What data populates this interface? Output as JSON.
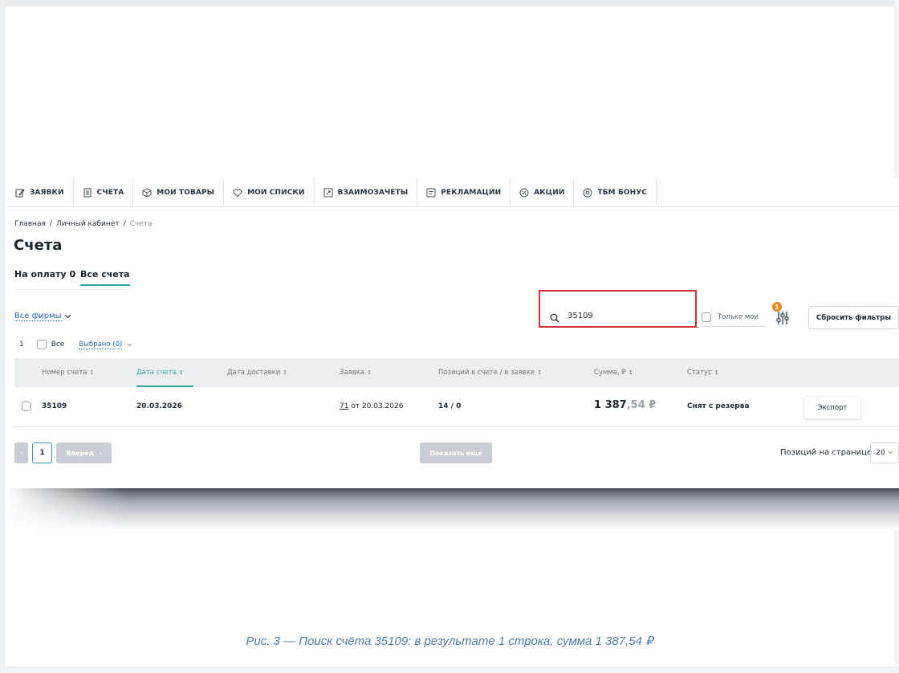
{
  "nav": {
    "items": [
      {
        "label": "ЗАЯВКИ",
        "icon": "edit-icon"
      },
      {
        "label": "СЧЕТА",
        "icon": "document-icon"
      },
      {
        "label": "МОИ ТОВАРЫ",
        "icon": "box-icon"
      },
      {
        "label": "МОИ СПИСКИ",
        "icon": "heart-icon"
      },
      {
        "label": "ВЗАИМОЗАЧЕТЫ",
        "icon": "exchange-icon"
      },
      {
        "label": "РЕКЛАМАЦИИ",
        "icon": "complaint-icon"
      },
      {
        "label": "АКЦИИ",
        "icon": "percent-icon"
      },
      {
        "label": "ТБМ БОНУС",
        "icon": "bonus-icon"
      }
    ]
  },
  "breadcrumb": {
    "home": "Главная",
    "cabinet": "Личный кабинет",
    "current": "Счета"
  },
  "page_title": "Счета",
  "tabs": {
    "to_pay": "На оплату 0",
    "all": "Все счета"
  },
  "filters": {
    "firms": "Все фирмы",
    "search_value": "35109",
    "only_mine": "Только мои",
    "filter_badge": "1",
    "reset": "Сбросить фильтры"
  },
  "selection": {
    "count": "1",
    "all_label": "Все",
    "selected_label": "Выбрано (0)"
  },
  "table": {
    "columns": [
      "Номер счета",
      "Дата счета",
      "Дата доставки",
      "Заявка",
      "Позиций в счете / в заявке",
      "Сумма, ₽",
      "Статус"
    ],
    "sort_mark": "↕",
    "rows": [
      {
        "number": "35109",
        "date": "20.03.2026",
        "delivery_date": "",
        "order_num": "71",
        "order_rest": " от 20.03.2026",
        "positions": "14 / 0",
        "sum_int": "1 387",
        "sum_dec": ",54 ₽",
        "status": "Снят с резерва",
        "export": "Экспорт"
      }
    ]
  },
  "pagination": {
    "prev": "‹",
    "current_page": "1",
    "next": "Вперед",
    "next_arrow": "›",
    "show_more": "Показать еще",
    "per_page_label": "Позиций на странице",
    "per_page_value": "20"
  },
  "caption": "Рис. 3 — Поиск счёта 35109: в результате 1 строка, сумма 1 387,54 ₽",
  "colors": {
    "accent": "#37a3a6",
    "highlight": "#d12f37",
    "link": "#2a6fb5",
    "badge": "#f08a1c",
    "caption": "#4f7ca7"
  }
}
